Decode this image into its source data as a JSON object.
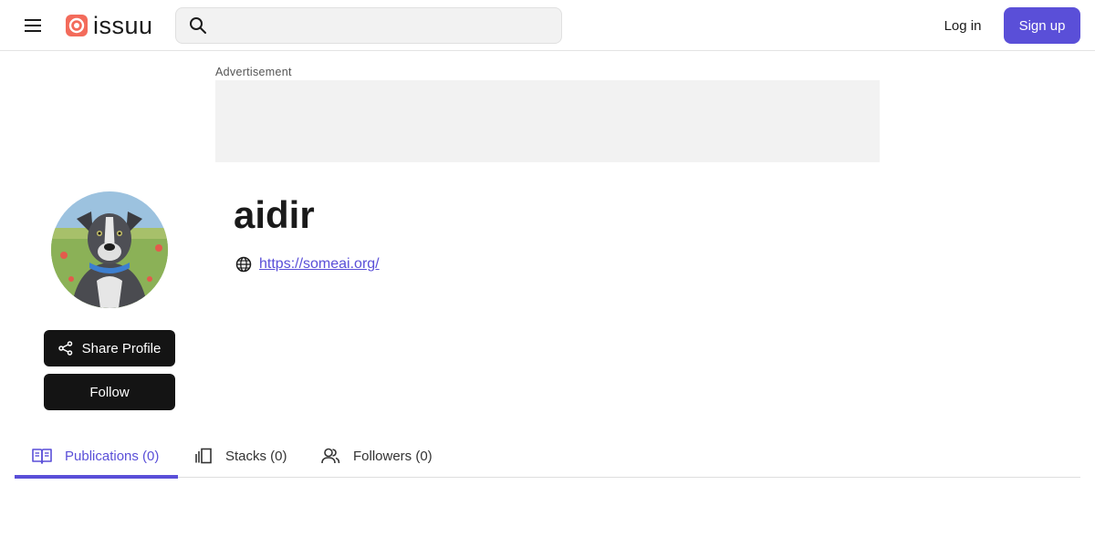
{
  "header": {
    "logo_text": "issuu",
    "search_placeholder": "",
    "login_label": "Log in",
    "signup_label": "Sign up"
  },
  "ad": {
    "label": "Advertisement"
  },
  "profile": {
    "name": "aidir",
    "website": "https://someai.org/",
    "share_label": "Share Profile",
    "follow_label": "Follow"
  },
  "tabs": [
    {
      "label": "Publications (0)",
      "icon": "book-open-icon",
      "active": true
    },
    {
      "label": "Stacks (0)",
      "icon": "stacks-icon",
      "active": false
    },
    {
      "label": "Followers (0)",
      "icon": "users-icon",
      "active": false
    }
  ],
  "colors": {
    "accent": "#5a4fd8",
    "brand_red": "#f36b5b",
    "button_dark": "#141414"
  }
}
